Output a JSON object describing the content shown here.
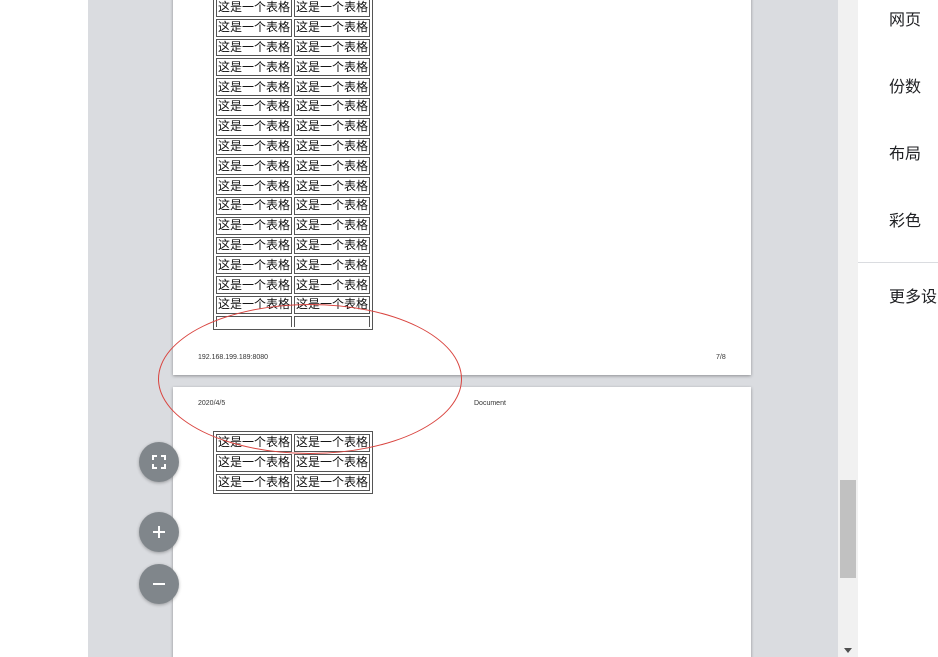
{
  "preview": {
    "cell_text": "这是一个表格",
    "page_1": {
      "footer_url": "192.168.199.189:8080",
      "page_number": "7/8",
      "table_rows": 16
    },
    "page_2": {
      "header_date": "2020/4/5",
      "header_title": "Document",
      "table_rows": 3
    }
  },
  "controls": {
    "fit_icon": "fit-to-page-icon",
    "zoom_in_icon": "zoom-in-icon",
    "zoom_out_icon": "zoom-out-icon"
  },
  "settings": {
    "items": [
      {
        "label": "网页"
      },
      {
        "label": "份数"
      },
      {
        "label": "布局"
      },
      {
        "label": "彩色"
      }
    ],
    "more_label": "更多设"
  },
  "colors": {
    "preview_bg": "#dadce0",
    "annotation": "#d9443f",
    "fab": "#80868b"
  }
}
